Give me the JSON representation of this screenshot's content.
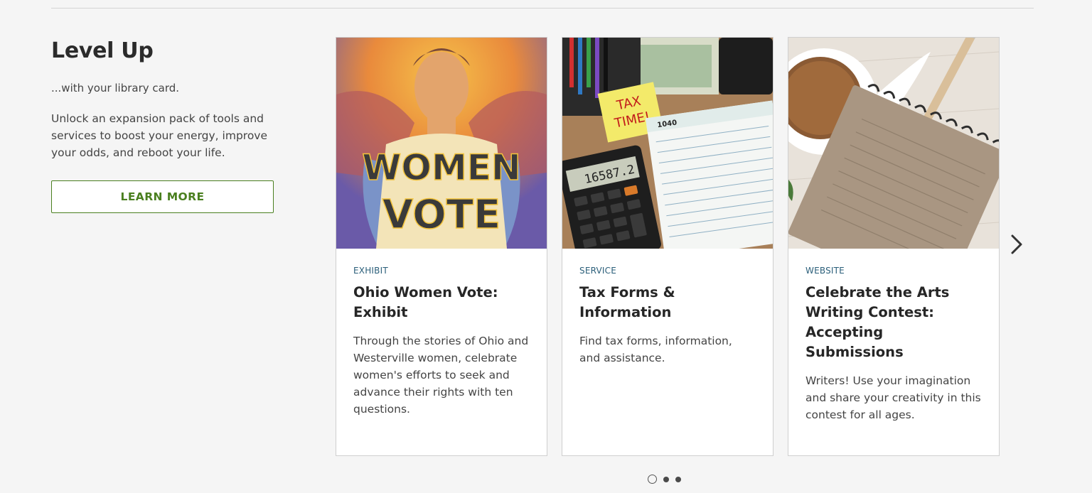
{
  "section": {
    "title": "Level Up",
    "subtitle": "...with your library card.",
    "description": "Unlock an expansion pack of tools and services to boost your energy, improve your odds, and reboot your life.",
    "button_label": "LEARN MORE"
  },
  "cards": [
    {
      "category": "EXHIBIT",
      "title": "Ohio Women Vote: Exhibit",
      "text": "Through the stories of Ohio and Westerville women, celebrate women's efforts to seek and advance their rights with ten questions.",
      "image_text_1": "WOMEN",
      "image_text_2": "VOTE"
    },
    {
      "category": "SERVICE",
      "title": "Tax Forms & Information",
      "text": "Find tax forms, information, and assistance.",
      "image_note_1": "TAX",
      "image_note_2": "TIME!",
      "image_calc": "16587.2",
      "image_form": "1040"
    },
    {
      "category": "WEBSITE",
      "title": "Celebrate the Arts Writing Contest: Accepting Submissions",
      "text": "Writers! Use your imagination and share your creativity in this contest for all ages."
    }
  ],
  "carousel": {
    "next_icon": "chevron-right-icon",
    "pages": 3,
    "active_page": 1
  },
  "colors": {
    "accent_green": "#4a7f1f",
    "category_blue": "#2b5f7a",
    "background": "#f5f5f5"
  }
}
